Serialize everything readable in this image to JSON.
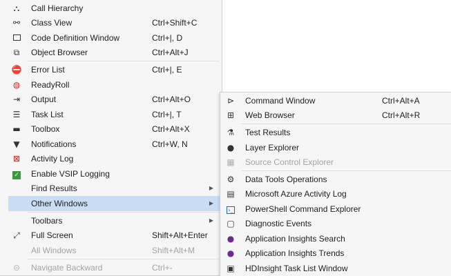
{
  "main_menu": {
    "items": [
      {
        "label": "Call Hierarchy",
        "shortcut": "",
        "icon": "call-hierarchy-icon",
        "glyph": "⛬"
      },
      {
        "label": "Class View",
        "shortcut": "Ctrl+Shift+C",
        "icon": "class-view-icon",
        "glyph": "⚯"
      },
      {
        "label": "Code Definition Window",
        "shortcut": "Ctrl+|, D",
        "icon": "code-definition-icon",
        "glyph": "▭"
      },
      {
        "label": "Object Browser",
        "shortcut": "Ctrl+Alt+J",
        "icon": "object-browser-icon",
        "glyph": "⧉"
      },
      {
        "label": "Error List",
        "shortcut": "Ctrl+|, E",
        "icon": "error-list-icon",
        "glyph": "⛔"
      },
      {
        "label": "ReadyRoll",
        "shortcut": "",
        "icon": "readyroll-icon",
        "glyph": "◍"
      },
      {
        "label": "Output",
        "shortcut": "Ctrl+Alt+O",
        "icon": "output-icon",
        "glyph": "⇥"
      },
      {
        "label": "Task List",
        "shortcut": "Ctrl+|, T",
        "icon": "task-list-icon",
        "glyph": "☰"
      },
      {
        "label": "Toolbox",
        "shortcut": "Ctrl+Alt+X",
        "icon": "toolbox-icon",
        "glyph": "▬"
      },
      {
        "label": "Notifications",
        "shortcut": "Ctrl+W, N",
        "icon": "notifications-icon",
        "glyph": "▼"
      },
      {
        "label": "Activity Log",
        "shortcut": "",
        "icon": "activity-log-icon",
        "glyph": "⊠"
      },
      {
        "label": "Enable VSIP Logging",
        "shortcut": "",
        "icon": "vsip-logging-icon",
        "glyph": "▣"
      },
      {
        "label": "Find Results",
        "shortcut": "",
        "icon": "",
        "glyph": ""
      },
      {
        "label": "Other Windows",
        "shortcut": "",
        "icon": "",
        "glyph": ""
      },
      {
        "label": "Toolbars",
        "shortcut": "",
        "icon": "",
        "glyph": ""
      },
      {
        "label": "Full Screen",
        "shortcut": "Shift+Alt+Enter",
        "icon": "full-screen-icon",
        "glyph": "⤢"
      },
      {
        "label": "All Windows",
        "shortcut": "Shift+Alt+M",
        "icon": "all-windows-icon",
        "glyph": ""
      },
      {
        "label": "Navigate Backward",
        "shortcut": "Ctrl+-",
        "icon": "navigate-backward-icon",
        "glyph": "⊝"
      }
    ],
    "arrow": "▶"
  },
  "submenu": {
    "items": [
      {
        "label": "Command Window",
        "shortcut": "Ctrl+Alt+A",
        "icon": "command-window-icon",
        "glyph": "⊳"
      },
      {
        "label": "Web Browser",
        "shortcut": "Ctrl+Alt+R",
        "icon": "web-browser-icon",
        "glyph": "⊞"
      },
      {
        "label": "Test Results",
        "shortcut": "",
        "icon": "test-results-icon",
        "glyph": "⚗"
      },
      {
        "label": "Layer Explorer",
        "shortcut": "",
        "icon": "layer-explorer-icon",
        "glyph": "●"
      },
      {
        "label": "Source Control Explorer",
        "shortcut": "",
        "icon": "source-control-explorer-icon",
        "glyph": "▦"
      },
      {
        "label": "Data Tools Operations",
        "shortcut": "",
        "icon": "data-tools-operations-icon",
        "glyph": "⚙"
      },
      {
        "label": "Microsoft Azure Activity Log",
        "shortcut": "",
        "icon": "azure-activity-log-icon",
        "glyph": "▤"
      },
      {
        "label": "PowerShell Command Explorer",
        "shortcut": "",
        "icon": "powershell-icon",
        "glyph": "›_"
      },
      {
        "label": "Diagnostic Events",
        "shortcut": "",
        "icon": "diagnostic-events-icon",
        "glyph": "▢"
      },
      {
        "label": "Application Insights Search",
        "shortcut": "",
        "icon": "app-insights-search-icon",
        "glyph": "💡"
      },
      {
        "label": "Application Insights Trends",
        "shortcut": "",
        "icon": "app-insights-trends-icon",
        "glyph": "💡"
      },
      {
        "label": "HDInsight Task List Window",
        "shortcut": "",
        "icon": "hdinsight-task-list-icon",
        "glyph": "▣"
      }
    ]
  },
  "colors": {
    "menu_bg": "#f6f6f6",
    "highlight": "#c9def5",
    "disabled_text": "#a2a4a5",
    "border": "#cccedb"
  }
}
